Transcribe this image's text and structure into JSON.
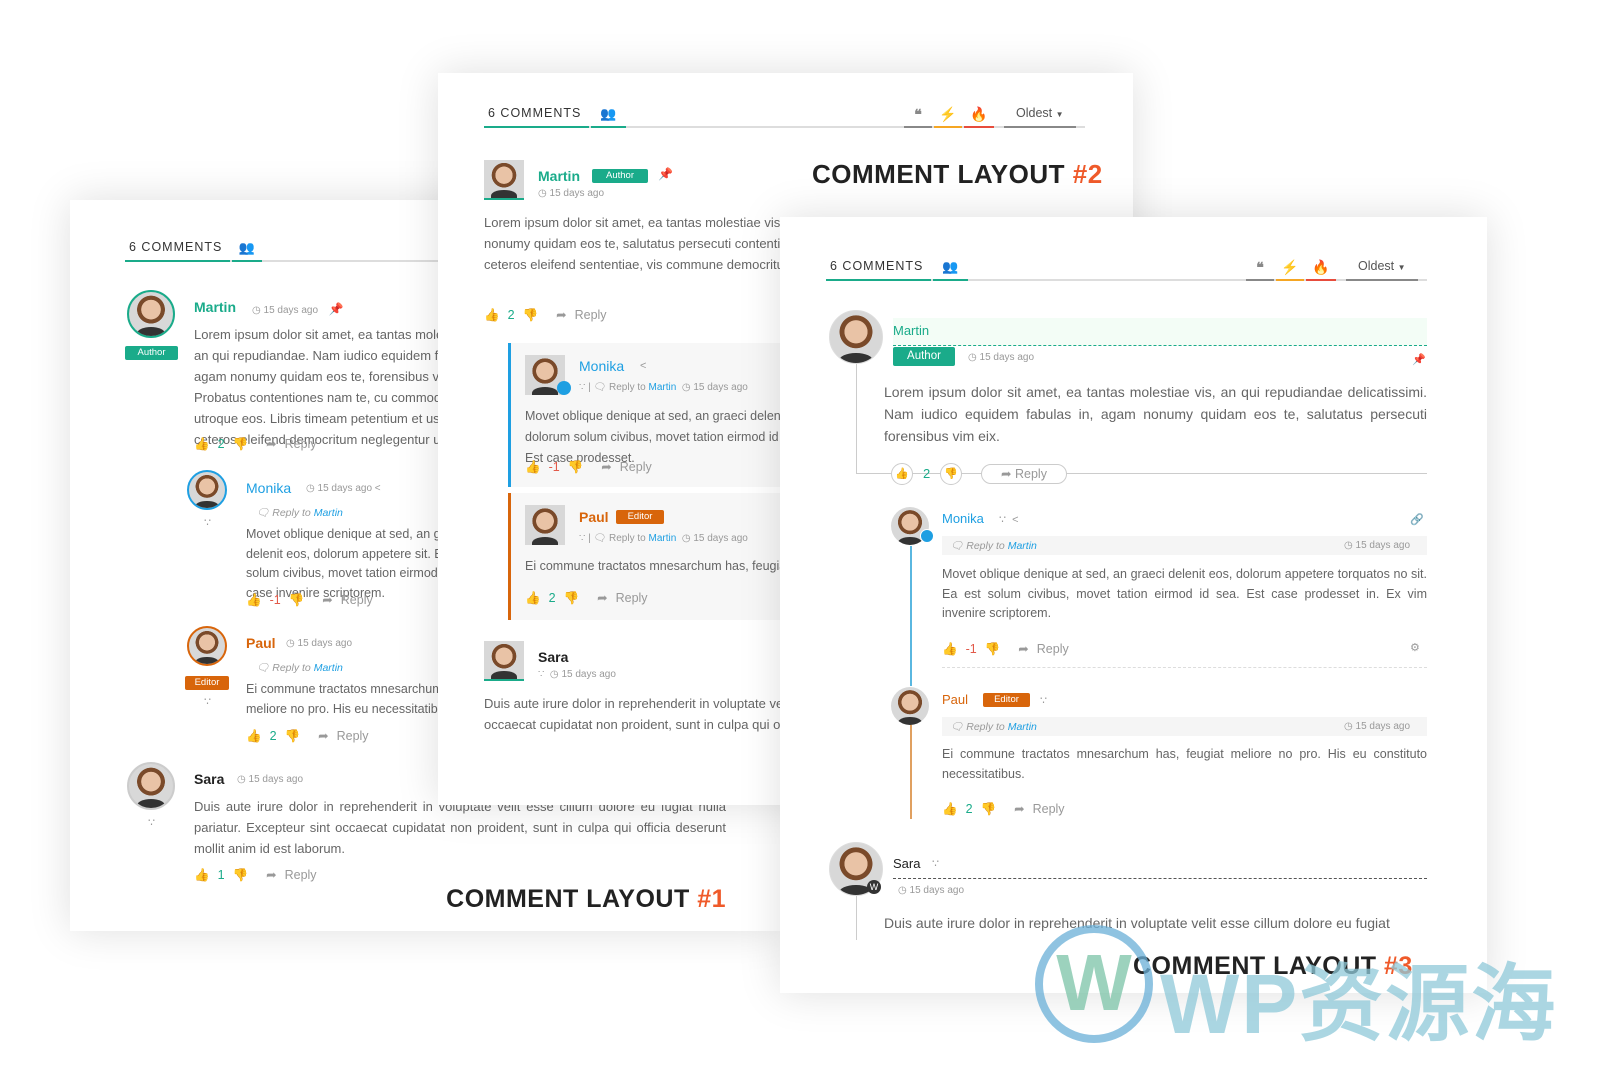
{
  "colors": {
    "accent": "#1aab8a",
    "author": "#1aab8a",
    "editor": "#d8650b",
    "link": "#1e9fe2",
    "downvote": "#e25a4a",
    "title_hash": "#ef5a2a"
  },
  "common": {
    "comments_tab": "6 COMMENTS",
    "sort": "Oldest",
    "time": "15 days ago",
    "reply": "Reply",
    "reply_to": "Reply to",
    "martin": "Martin",
    "author": "Author",
    "editor": "Editor"
  },
  "icons": [
    "users-gear-icon",
    "quote-icon",
    "bolt-icon",
    "fire-icon",
    "chevron-down-icon",
    "clock-icon",
    "pin-icon",
    "thumbs-up-icon",
    "thumbs-down-icon",
    "reply-arrow-icon",
    "share-icon",
    "rss-icon",
    "twitter-icon",
    "wordpress-icon",
    "link-icon",
    "gear-icon",
    "comments-icon"
  ],
  "layout1": {
    "title": "COMMENT LAYOUT ",
    "num": "#1",
    "martin": {
      "name": "Martin",
      "text": "Lorem ipsum dolor sit amet, ea tantas molestiae vis, an qui repudiandae. Nam iudico equidem fabulas in, agam nonumy quidam eos te, forensibus vim eix. Probatus contentiones nam te, cu commodo utroque eos. Libris timeam petentium et usu, cu ne ceteros eleifend democritum neglegentur ut.",
      "votes": "2"
    },
    "monika": {
      "name": "Monika",
      "text": "Movet oblique denique at sed, an graeci delenit eos, dolorum appetere sit. Ea est solum civibus, movet tation eirmod id sea. Est case invenire scriptorem.",
      "votes": "-1"
    },
    "paul": {
      "name": "Paul",
      "text": "Ei commune tractatos mnesarchum has, feugiat meliore no pro. His eu necessitatibus.",
      "votes": "2"
    },
    "sara": {
      "name": "Sara",
      "text": "Duis aute irure dolor in reprehenderit in voluptate velit esse cillum dolore eu fugiat nulla pariatur. Excepteur sint occaecat cupidatat non proident, sunt in culpa qui officia deserunt mollit anim id est laborum.",
      "votes": "1"
    }
  },
  "layout2": {
    "title": "COMMENT LAYOUT ",
    "num": "#2",
    "martin": {
      "name": "Martin",
      "text": "Lorem ipsum dolor sit amet, ea tantas molestiae vis, an qui repudiandae equidem fabulas in, agam nonumy quidam eos te, salutatus persecuti contentiones nam te, cu commodo utroque consulatu ne ceteros eleifend sententiae, vis commune democritum.",
      "votes": "2"
    },
    "monika": {
      "name": "Monika",
      "text": "Movet oblique denique at sed, an graeci delenit eos, dolorum solum civibus, movet tation eirmod id sea. Est case prodesset.",
      "votes": "-1"
    },
    "paul": {
      "name": "Paul",
      "text": "Ei commune tractatos mnesarchum has, feugiat meliore no pro.",
      "votes": "2"
    },
    "sara": {
      "name": "Sara",
      "text": "Duis aute irure dolor in reprehenderit in voluptate velit esse cillum Excepteur sint occaecat cupidatat non proident, sunt in culpa qui officia laborum."
    }
  },
  "layout3": {
    "title": "COMMENT LAYOUT ",
    "num": "#3",
    "martin": {
      "name": "Martin",
      "text": "Lorem ipsum dolor sit amet, ea tantas molestiae vis, an qui repudiandae delicatissimi. Nam iudico equidem fabulas in, agam nonumy quidam eos te, salutatus persecuti forensibus vim eix.",
      "votes": "2"
    },
    "monika": {
      "name": "Monika",
      "text": "Movet oblique denique at sed, an graeci delenit eos, dolorum appetere torquatos no sit. Ea est solum civibus, movet tation eirmod id sea. Est case prodesset in. Ex vim invenire scriptorem.",
      "votes": "-1"
    },
    "paul": {
      "name": "Paul",
      "text": "Ei commune tractatos mnesarchum has, feugiat meliore no pro. His eu constituto necessitatibus.",
      "votes": "2"
    },
    "sara": {
      "name": "Sara",
      "text": "Duis aute irure dolor in reprehenderit in voluptate velit esse cillum dolore eu fugiat"
    }
  },
  "watermark": {
    "text": "WP资源海"
  }
}
